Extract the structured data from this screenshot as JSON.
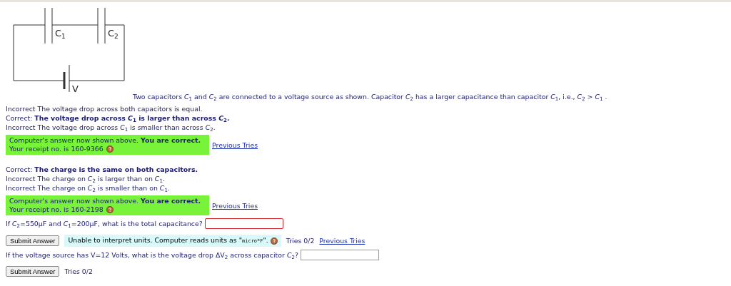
{
  "circuit": {
    "labels": [
      {
        "main": "C",
        "sub": "1"
      },
      {
        "main": "C",
        "sub": "2"
      },
      {
        "main": "V"
      }
    ]
  },
  "intro": "Two capacitors *C*$_{1}$ and *C*$_{2}$ are connected to a voltage source as shown. Capacitor *C*$_{2}$ has a larger capacitance than capacitor *C*$_{1}$, i.e., *C*$_{2}$ > *C*$_{1}$ .",
  "questions": [
    {
      "kind": "choice",
      "options": [
        {
          "verdict": "Incorrect",
          "text": "The voltage drop across both capacitors is equal.",
          "correct": false
        },
        {
          "verdict": "Correct:",
          "text": "The voltage drop across *C*$_{1}$ is larger than across *C*$_{2}$.",
          "correct": true
        },
        {
          "verdict": "Incorrect",
          "text": "The voltage drop across *C*$_{1}$ is smaller than across *C*$_{2}$.",
          "correct": false
        }
      ],
      "feedback": {
        "line1": "Computer's answer now shown above.",
        "verdict": "You are correct.",
        "receipt": "Your receipt no. is 160-9366"
      },
      "link": "Previous Tries"
    },
    {
      "kind": "choice",
      "options": [
        {
          "verdict": "Correct:",
          "text": "The charge is the same on both capacitors.",
          "correct": true
        },
        {
          "verdict": "Incorrect",
          "text": "The charge on *C*$_{2}$ is larger than on *C*$_{1}$.",
          "correct": false
        },
        {
          "verdict": "Incorrect",
          "text": "The charge on *C*$_{2}$ is smaller than on *C*$_{1}$.",
          "correct": false
        }
      ],
      "feedback": {
        "line1": "Computer's answer now shown above.",
        "verdict": "You are correct.",
        "receipt": "Your receipt no. is 160-2198"
      },
      "link": "Previous Tries"
    },
    {
      "kind": "numeric",
      "prompt": "If *C*$_{2}$=550μF and *C*$_{1}$=200μF, what is the total capacitance?",
      "invalid": true,
      "button": "Submit Answer",
      "warning_text": "Unable to interpret units. Computer reads units as \"",
      "warning_code": "micro*F",
      "warning_end": "\".",
      "tries": "Tries 0/2",
      "link": "Previous Tries"
    },
    {
      "kind": "numeric",
      "prompt": "If the voltage source has V=12 Volts, what is the voltage drop ΔV$_{2}$ across capacitor *C*$_{2}$?",
      "invalid": false,
      "button": "Submit Answer",
      "tries": "Tries 0/2"
    }
  ]
}
